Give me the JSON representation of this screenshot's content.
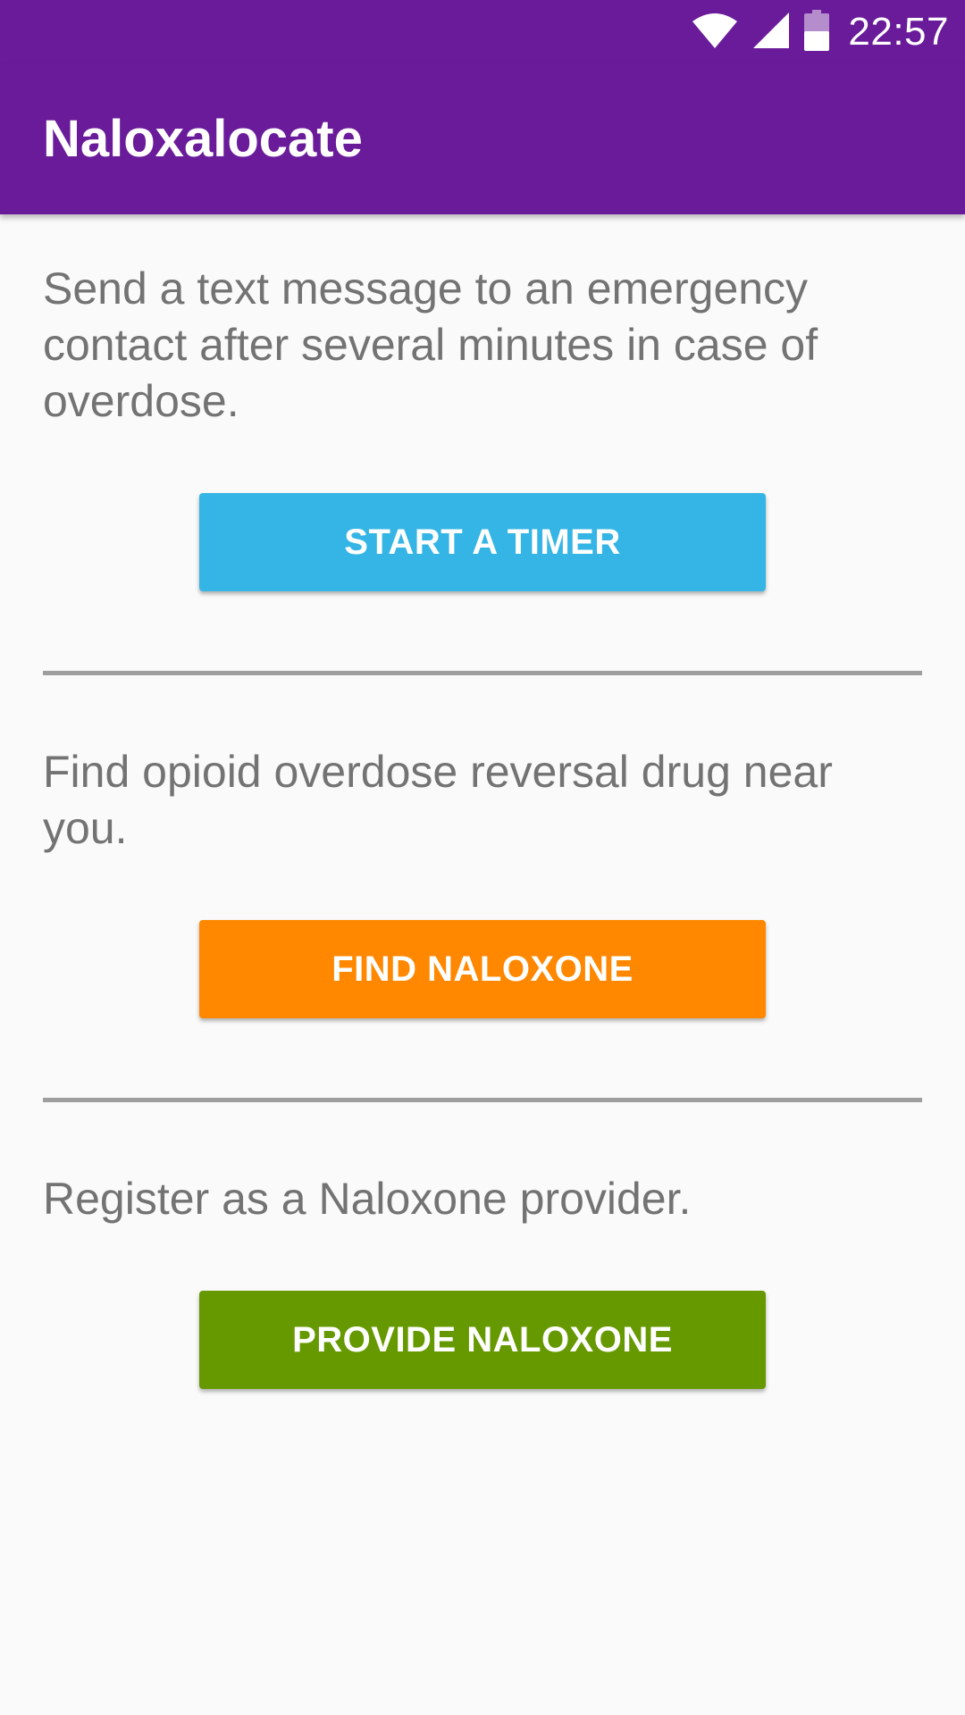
{
  "status_bar": {
    "time": "22:57",
    "icons": [
      "wifi-icon",
      "cell-signal-icon",
      "battery-icon"
    ]
  },
  "app_bar": {
    "title": "Naloxalocate"
  },
  "sections": [
    {
      "description": "Send a text message to an emergency contact after several minutes in case of overdose.",
      "button_label": "START A TIMER",
      "button_color": "#35b5e5"
    },
    {
      "description": "Find opioid overdose reversal drug near you.",
      "button_label": "FIND NALOXONE",
      "button_color": "#ff8800"
    },
    {
      "description": "Register as a Naloxone provider.",
      "button_label": "PROVIDE NALOXONE",
      "button_color": "#669900"
    }
  ],
  "colors": {
    "primary": "#6a1b9a",
    "background": "#fafafa",
    "text": "#737373",
    "divider": "#9e9e9e"
  }
}
